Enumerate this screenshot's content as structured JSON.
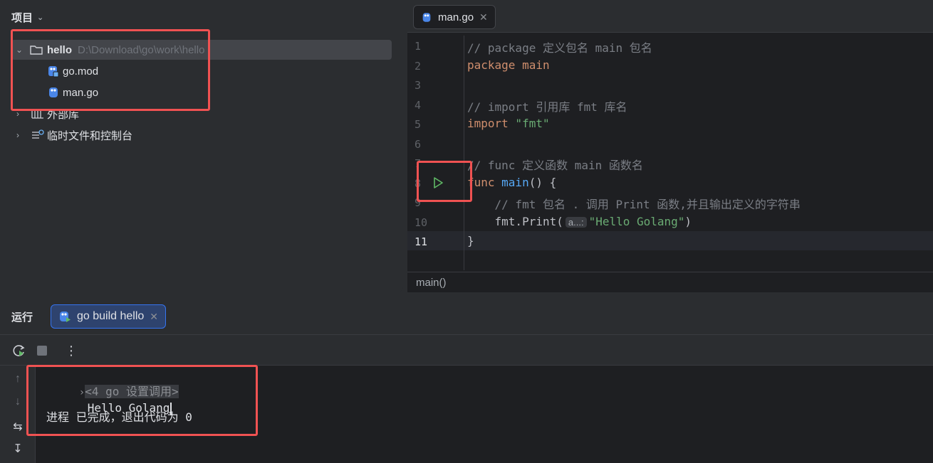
{
  "project": {
    "title": "项目",
    "root": {
      "name": "hello",
      "path": "D:\\Download\\go\\work\\hello"
    },
    "files": [
      "go.mod",
      "man.go"
    ],
    "external_libs": "外部库",
    "scratches": "临时文件和控制台"
  },
  "editor": {
    "tab": "man.go",
    "line_numbers": [
      "1",
      "2",
      "3",
      "4",
      "5",
      "6",
      "7",
      "8",
      "9",
      "10",
      "11"
    ],
    "lines": {
      "l1": "// package 定义包名 main 包名",
      "l2_kw": "package",
      "l2_name": " main",
      "l4": "// import 引用库 fmt 库名",
      "l5_kw": "import",
      "l5_str": " \"fmt\"",
      "l7": "// func 定义函数 main 函数名",
      "l8_kw": "func",
      "l8_fn": " main",
      "l8_rest": "() {",
      "l9": "    // fmt 包名 . 调用 Print 函数,并且输出定义的字符串",
      "l10_pkg": "    fmt.",
      "l10_fn": "Print",
      "l10_open": "(",
      "l10_hint": "a...:",
      "l10_str": "\"Hello Golang\"",
      "l10_close": ")",
      "l11": "}"
    },
    "breadcrumb": "main()"
  },
  "run": {
    "title": "运行",
    "tab": "go build hello",
    "console": {
      "collapsed": "<4 go 设置调用>",
      "output": "Hello Golang",
      "exit": "进程 已完成，退出代码为 0"
    }
  },
  "colors": {
    "highlight": "#f05252",
    "accent": "#3574f0",
    "run_green": "#5fb865"
  }
}
